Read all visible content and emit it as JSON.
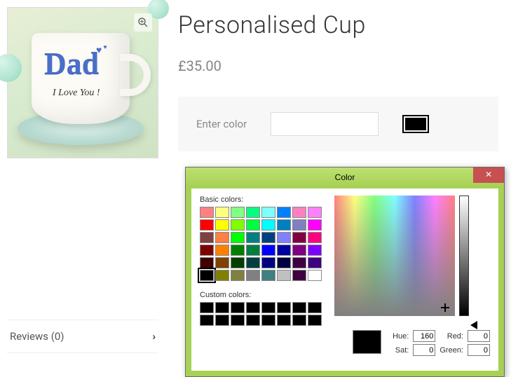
{
  "product": {
    "title": "Personalised Cup",
    "price": "£35.00",
    "image_text": "Dad",
    "image_sub": "I Love You !"
  },
  "reviews": {
    "label": "Reviews (0)"
  },
  "field": {
    "label": "Enter color",
    "value": ""
  },
  "dialog": {
    "title": "Color",
    "basic_label": "Basic colors:",
    "custom_label": "Custom colors:",
    "basic_colors": [
      "#ff8080",
      "#ffff80",
      "#80ff80",
      "#00ff80",
      "#80ffff",
      "#0080ff",
      "#ff80c0",
      "#ff80ff",
      "#ff0000",
      "#ffff00",
      "#80ff00",
      "#00ff40",
      "#00ffff",
      "#0080c0",
      "#8080c0",
      "#ff00ff",
      "#804040",
      "#ff8040",
      "#00ff00",
      "#008080",
      "#004080",
      "#8080ff",
      "#800040",
      "#ff0080",
      "#800000",
      "#ff8000",
      "#008000",
      "#008040",
      "#0000ff",
      "#0000a0",
      "#800080",
      "#8000ff",
      "#400000",
      "#804000",
      "#004000",
      "#004040",
      "#000080",
      "#000040",
      "#400040",
      "#400080",
      "#000000",
      "#808000",
      "#808040",
      "#808080",
      "#408080",
      "#c0c0c0",
      "#400040",
      "#ffffff"
    ],
    "custom_colors": [
      "#000000",
      "#000000",
      "#000000",
      "#000000",
      "#000000",
      "#000000",
      "#000000",
      "#000000",
      "#000000",
      "#000000",
      "#000000",
      "#000000",
      "#000000",
      "#000000",
      "#000000",
      "#000000"
    ],
    "hue_label": "Hue:",
    "hue": "160",
    "sat_label": "Sat:",
    "sat": "0",
    "red_label": "Red:",
    "red": "0",
    "green_label": "Green:",
    "green": "0"
  }
}
